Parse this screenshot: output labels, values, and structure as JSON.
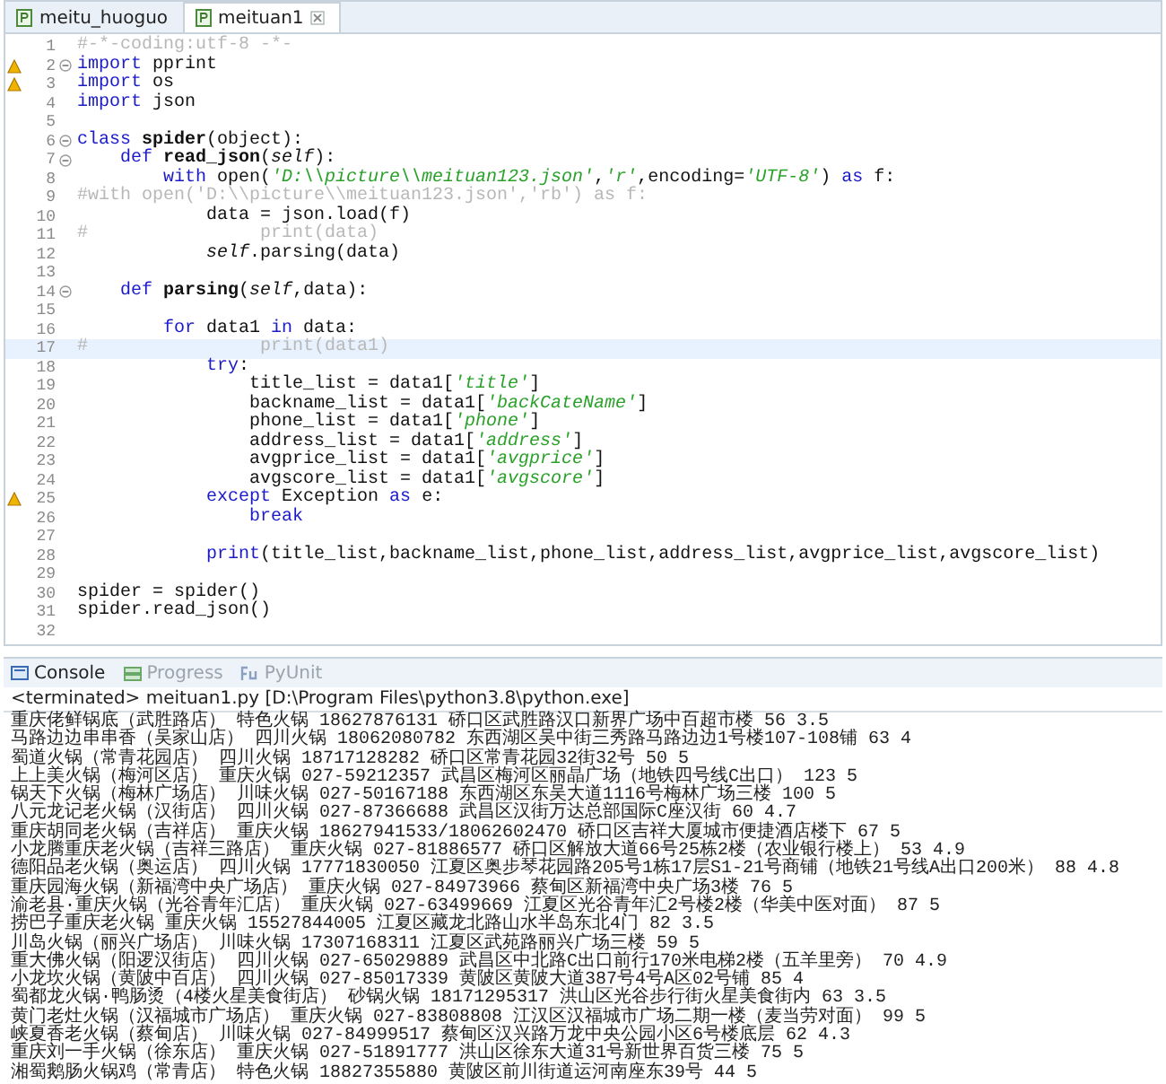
{
  "editor_tabs": [
    {
      "label": "meitu_huoguo",
      "selected": false
    },
    {
      "label": "meituan1",
      "selected": true
    }
  ],
  "code_lines": [
    {
      "number": "1",
      "fold": false,
      "warning": false,
      "current": false,
      "tokens": [
        {
          "t": "#-*-coding:utf-8 -*-",
          "kind": "comment"
        }
      ]
    },
    {
      "number": "2",
      "fold": true,
      "warning": true,
      "current": false,
      "tokens": [
        {
          "t": "import",
          "kind": "keyword"
        },
        {
          "t": " pprint",
          "kind": "plain"
        }
      ]
    },
    {
      "number": "3",
      "fold": false,
      "warning": true,
      "current": false,
      "tokens": [
        {
          "t": "import",
          "kind": "keyword"
        },
        {
          "t": " os",
          "kind": "plain"
        }
      ]
    },
    {
      "number": "4",
      "fold": false,
      "warning": false,
      "current": false,
      "tokens": [
        {
          "t": "import",
          "kind": "keyword"
        },
        {
          "t": " json",
          "kind": "plain"
        }
      ]
    },
    {
      "number": "5",
      "fold": false,
      "warning": false,
      "current": false
    },
    {
      "number": "6",
      "fold": true,
      "warning": false,
      "current": false,
      "tokens": [
        {
          "t": "class ",
          "kind": "keyword"
        },
        {
          "t": "spider",
          "kind": "name"
        },
        {
          "t": "(object):",
          "kind": "plain"
        }
      ]
    },
    {
      "number": "7",
      "fold": true,
      "warning": false,
      "current": false,
      "tokens": [
        {
          "t": "    def ",
          "kind": "keyword"
        },
        {
          "t": "read_json",
          "kind": "name"
        },
        {
          "t": "(",
          "kind": "plain"
        },
        {
          "t": "self",
          "kind": "self"
        },
        {
          "t": "):",
          "kind": "plain"
        }
      ]
    },
    {
      "number": "8",
      "fold": false,
      "warning": false,
      "current": false,
      "tokens": [
        {
          "t": "        with",
          "kind": "keyword"
        },
        {
          "t": " open(",
          "kind": "plain"
        },
        {
          "t": "'D:\\\\picture\\\\meituan123.json'",
          "kind": "string"
        },
        {
          "t": ",",
          "kind": "plain"
        },
        {
          "t": "'r'",
          "kind": "string"
        },
        {
          "t": ",encoding=",
          "kind": "plain"
        },
        {
          "t": "'UTF-8'",
          "kind": "string"
        },
        {
          "t": ") ",
          "kind": "plain"
        },
        {
          "t": "as",
          "kind": "keyword"
        },
        {
          "t": " f:",
          "kind": "plain"
        }
      ]
    },
    {
      "number": "9",
      "fold": false,
      "warning": false,
      "current": false,
      "tokens": [
        {
          "t": "#with open('D:\\\\picture\\\\meituan123.json','rb') as f:",
          "kind": "comment"
        }
      ]
    },
    {
      "number": "10",
      "fold": false,
      "warning": false,
      "current": false,
      "tokens": [
        {
          "t": "            data = json.load(f)",
          "kind": "plain"
        }
      ]
    },
    {
      "number": "11",
      "fold": false,
      "warning": false,
      "current": false,
      "tokens": [
        {
          "t": "#                print(data)",
          "kind": "comment"
        }
      ]
    },
    {
      "number": "12",
      "fold": false,
      "warning": false,
      "current": false,
      "tokens": [
        {
          "t": "            self",
          "kind": "self"
        },
        {
          "t": ".parsing(data)",
          "kind": "plain"
        }
      ]
    },
    {
      "number": "13",
      "fold": false,
      "warning": false,
      "current": false
    },
    {
      "number": "14",
      "fold": true,
      "warning": false,
      "current": false,
      "tokens": [
        {
          "t": "    def ",
          "kind": "keyword"
        },
        {
          "t": "parsing",
          "kind": "name"
        },
        {
          "t": "(",
          "kind": "plain"
        },
        {
          "t": "self",
          "kind": "self"
        },
        {
          "t": ",data):",
          "kind": "plain"
        }
      ]
    },
    {
      "number": "15",
      "fold": false,
      "warning": false,
      "current": false
    },
    {
      "number": "16",
      "fold": false,
      "warning": false,
      "current": false,
      "tokens": [
        {
          "t": "        for",
          "kind": "keyword"
        },
        {
          "t": " data1 ",
          "kind": "plain"
        },
        {
          "t": "in",
          "kind": "keyword"
        },
        {
          "t": " data:",
          "kind": "plain"
        }
      ]
    },
    {
      "number": "17",
      "fold": false,
      "warning": false,
      "current": true,
      "tokens": [
        {
          "t": "#                print(data1)",
          "kind": "comment"
        }
      ]
    },
    {
      "number": "18",
      "fold": false,
      "warning": false,
      "current": false,
      "tokens": [
        {
          "t": "            try",
          "kind": "keyword"
        },
        {
          "t": ":",
          "kind": "plain"
        }
      ]
    },
    {
      "number": "19",
      "fold": false,
      "warning": false,
      "current": false,
      "tokens": [
        {
          "t": "                title_list = data1[",
          "kind": "plain"
        },
        {
          "t": "'title'",
          "kind": "string"
        },
        {
          "t": "]",
          "kind": "plain"
        }
      ]
    },
    {
      "number": "20",
      "fold": false,
      "warning": false,
      "current": false,
      "tokens": [
        {
          "t": "                backname_list = data1[",
          "kind": "plain"
        },
        {
          "t": "'backCateName'",
          "kind": "string"
        },
        {
          "t": "]",
          "kind": "plain"
        }
      ]
    },
    {
      "number": "21",
      "fold": false,
      "warning": false,
      "current": false,
      "tokens": [
        {
          "t": "                phone_list = data1[",
          "kind": "plain"
        },
        {
          "t": "'phone'",
          "kind": "string"
        },
        {
          "t": "]",
          "kind": "plain"
        }
      ]
    },
    {
      "number": "22",
      "fold": false,
      "warning": false,
      "current": false,
      "tokens": [
        {
          "t": "                address_list = data1[",
          "kind": "plain"
        },
        {
          "t": "'address'",
          "kind": "string"
        },
        {
          "t": "]",
          "kind": "plain"
        }
      ]
    },
    {
      "number": "23",
      "fold": false,
      "warning": false,
      "current": false,
      "tokens": [
        {
          "t": "                avgprice_list = data1[",
          "kind": "plain"
        },
        {
          "t": "'avgprice'",
          "kind": "string"
        },
        {
          "t": "]",
          "kind": "plain"
        }
      ]
    },
    {
      "number": "24",
      "fold": false,
      "warning": false,
      "current": false,
      "tokens": [
        {
          "t": "                avgscore_list = data1[",
          "kind": "plain"
        },
        {
          "t": "'avgscore'",
          "kind": "string"
        },
        {
          "t": "]",
          "kind": "plain"
        }
      ]
    },
    {
      "number": "25",
      "fold": false,
      "warning": true,
      "current": false,
      "tokens": [
        {
          "t": "            except",
          "kind": "keyword"
        },
        {
          "t": " Exception ",
          "kind": "plain"
        },
        {
          "t": "as",
          "kind": "keyword"
        },
        {
          "t": " e:",
          "kind": "plain"
        }
      ]
    },
    {
      "number": "26",
      "fold": false,
      "warning": false,
      "current": false,
      "tokens": [
        {
          "t": "                break",
          "kind": "keyword"
        }
      ]
    },
    {
      "number": "27",
      "fold": false,
      "warning": false,
      "current": false
    },
    {
      "number": "28",
      "fold": false,
      "warning": false,
      "current": false,
      "tokens": [
        {
          "t": "            print",
          "kind": "keyword"
        },
        {
          "t": "(title_list,backname_list,phone_list,address_list,avgprice_list,avgscore_list)",
          "kind": "plain"
        }
      ]
    },
    {
      "number": "29",
      "fold": false,
      "warning": false,
      "current": false
    },
    {
      "number": "30",
      "fold": false,
      "warning": false,
      "current": false,
      "tokens": [
        {
          "t": "spider = spider()",
          "kind": "plain"
        }
      ]
    },
    {
      "number": "31",
      "fold": false,
      "warning": false,
      "current": false,
      "tokens": [
        {
          "t": "spider.read_json()",
          "kind": "plain"
        }
      ]
    },
    {
      "number": "32",
      "fold": false,
      "warning": false,
      "current": false
    }
  ],
  "console_tabs": [
    {
      "label": "Console",
      "selected": true,
      "kind": "console"
    },
    {
      "label": "Progress",
      "selected": false,
      "kind": "progress"
    },
    {
      "label": "PyUnit",
      "selected": false,
      "kind": "pyunit"
    }
  ],
  "console_status": "<terminated> meituan1.py [D:\\Program Files\\python3.8\\python.exe]",
  "console_lines": [
    "重庆佬鲜锅底（武胜路店） 特色火锅 18627876131 硚口区武胜路汉口新界广场中百超市楼 56 3.5",
    "马路边边串串香（吴家山店） 四川火锅 18062080782 东西湖区吴中街三秀路马路边边1号楼107-108铺 63 4",
    "蜀道火锅（常青花园店） 四川火锅 18717128282 硚口区常青花园32街32号 50 5",
    "上上美火锅（梅河区店） 重庆火锅 027-59212357 武昌区梅河区丽晶广场（地铁四号线C出口） 123 5",
    "锅天下火锅（梅林广场店） 川味火锅 027-50167188 东西湖区东吴大道1116号梅林广场三楼 100 5",
    "八元龙记老火锅（汉街店） 四川火锅 027-87366688 武昌区汉街万达总部国际C座汉街 60 4.7",
    "重庆胡同老火锅（吉祥店） 重庆火锅 18627941533/18062602470 硚口区吉祥大厦城市便捷酒店楼下 67 5",
    "小龙腾重庆老火锅（吉祥三路店） 重庆火锅 027-81886577 硚口区解放大道66号25栋2楼（农业银行楼上） 53 4.9",
    "德阳品老火锅（奥运店） 四川火锅 17771830050 江夏区奥步琴花园路205号1栋17层S1-21号商铺（地铁21号线A出口200米） 88 4.8",
    "重庆园海火锅（新福湾中央广场店） 重庆火锅 027-84973966 蔡甸区新福湾中央广场3楼 76 5",
    "渝老县·重庆火锅（光谷青年汇店） 重庆火锅 027-63499669 江夏区光谷青年汇2号楼2楼（华美中医对面） 87 5",
    "捞巴子重庆老火锅 重庆火锅 15527844005 江夏区藏龙北路山水半岛东北4门 82 3.5",
    "川岛火锅（丽兴广场店） 川味火锅 17307168311 江夏区武苑路丽兴广场三楼 59 5",
    "重大佛火锅（阳逻汉街店） 四川火锅 027-65029889 武昌区中北路C出口前行170米电梯2楼（五羊里旁） 70 4.9",
    "小龙坎火锅（黄陂中百店） 四川火锅 027-85017339 黄陂区黄陂大道387号4号A区02号铺 85 4",
    "蜀都龙火锅·鸭肠烫（4楼火星美食街店） 砂锅火锅 18171295317 洪山区光谷步行街火星美食街内 63 3.5",
    "黄门老灶火锅（汉福城市广场店） 重庆火锅 027-83808808 江汉区汉福城市广场二期一楼（麦当劳对面） 99 5",
    "峡夏香老火锅（蔡甸店） 川味火锅 027-84999517 蔡甸区汉兴路万龙中央公园小区6号楼底层 62 4.3",
    "重庆刘一手火锅（徐东店） 重庆火锅 027-51891777 洪山区徐东大道31号新世界百货三楼 75 5",
    "湘蜀鹅肠火锅鸡（常青店） 特色火锅 18827355880 黄陂区前川街道运河南座东39号 44 5"
  ]
}
